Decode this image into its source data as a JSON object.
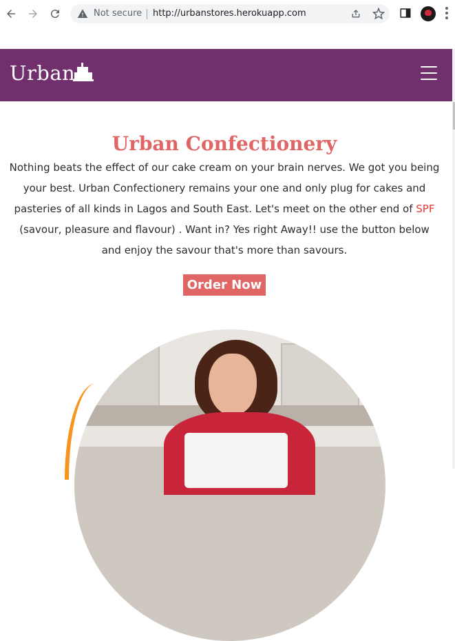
{
  "browser": {
    "security_label": "Not secure",
    "url": "http://urbanstores.herokuapp.com"
  },
  "header": {
    "logo_text": "Urban",
    "logo_icon": "cake-icon",
    "menu_icon": "hamburger-menu-icon",
    "background": "#722f6d"
  },
  "hero": {
    "title": "Urban Confectionery",
    "text_before": "Nothing beats the effect of our cake cream on your brain nerves. We got you being your best. Urban Confectionery remains your one and only plug for cakes and pasteries of all kinds in Lagos and South East. Let's meet on the other end of ",
    "accent_text": "SPF",
    "text_after": " (savour, pleasure and flavour) . Want in? Yes right Away!! use the button below and enjoy the savour that's more than savours.",
    "button_label": "Order Now",
    "title_color": "#e06666",
    "accent_color": "#e53935",
    "button_color": "#e06666",
    "arc_color": "#f7941d"
  }
}
